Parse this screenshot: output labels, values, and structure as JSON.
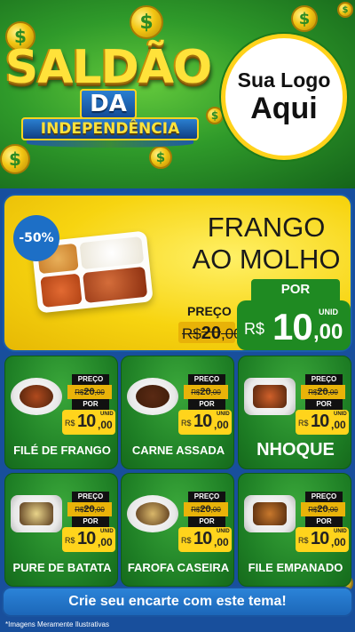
{
  "header": {
    "title_line1": "SALDÃO",
    "title_line2": "DA",
    "title_line3": "INDEPENDÊNCIA",
    "logo_line1": "Sua Logo",
    "logo_line2": "Aqui",
    "coin_symbol": "$"
  },
  "featured": {
    "discount": "-50%",
    "name_line1": "FRANGO",
    "name_line2": "AO MOLHO",
    "preco_label": "PREÇO",
    "old_currency": "R$",
    "old_int": "20",
    "old_dec": ",00",
    "por_label": "POR",
    "currency": "R$",
    "price_int": "10",
    "price_dec": ",00",
    "unit": "UNID"
  },
  "products": [
    {
      "name": "FILÉ DE FRANGO",
      "preco_label": "PREÇO",
      "old_currency": "R$",
      "old_int": "20",
      "old_dec": ",00",
      "por_label": "POR",
      "currency": "R$",
      "price_int": "10",
      "price_dec": ",00",
      "unit": "UNID",
      "food_color": "#b04a1e",
      "plate": "round"
    },
    {
      "name": "CARNE ASSADA",
      "preco_label": "PREÇO",
      "old_currency": "R$",
      "old_int": "20",
      "old_dec": ",00",
      "por_label": "POR",
      "currency": "R$",
      "price_int": "10",
      "price_dec": ",00",
      "unit": "UNID",
      "food_color": "#5a2a14",
      "plate": "round"
    },
    {
      "name": "NHOQUE",
      "preco_label": "PREÇO",
      "old_currency": "R$",
      "old_int": "20",
      "old_dec": ",00",
      "por_label": "POR",
      "currency": "R$",
      "price_int": "10",
      "price_dec": ",00",
      "unit": "UNID",
      "food_color": "#d0602a",
      "plate": "tray"
    },
    {
      "name": "PURE DE BATATA",
      "preco_label": "PREÇO",
      "old_currency": "R$",
      "old_int": "20",
      "old_dec": ",00",
      "por_label": "POR",
      "currency": "R$",
      "price_int": "10",
      "price_dec": ",00",
      "unit": "UNID",
      "food_color": "#e9d48a",
      "plate": "tray"
    },
    {
      "name": "FAROFA CASEIRA",
      "preco_label": "PREÇO",
      "old_currency": "R$",
      "old_int": "20",
      "old_dec": ",00",
      "por_label": "POR",
      "currency": "R$",
      "price_int": "10",
      "price_dec": ",00",
      "unit": "UNID",
      "food_color": "#d9b76a",
      "plate": "round"
    },
    {
      "name": "FILE EMPANADO",
      "preco_label": "PREÇO",
      "old_currency": "R$",
      "old_int": "20",
      "old_dec": ",00",
      "por_label": "POR",
      "currency": "R$",
      "price_int": "10",
      "price_dec": ",00",
      "unit": "UNID",
      "food_color": "#c8782c",
      "plate": "tray"
    }
  ],
  "cta": "Crie seu encarte com este tema!",
  "disclaimer": "*Imagens Meramente Ilustrativas"
}
